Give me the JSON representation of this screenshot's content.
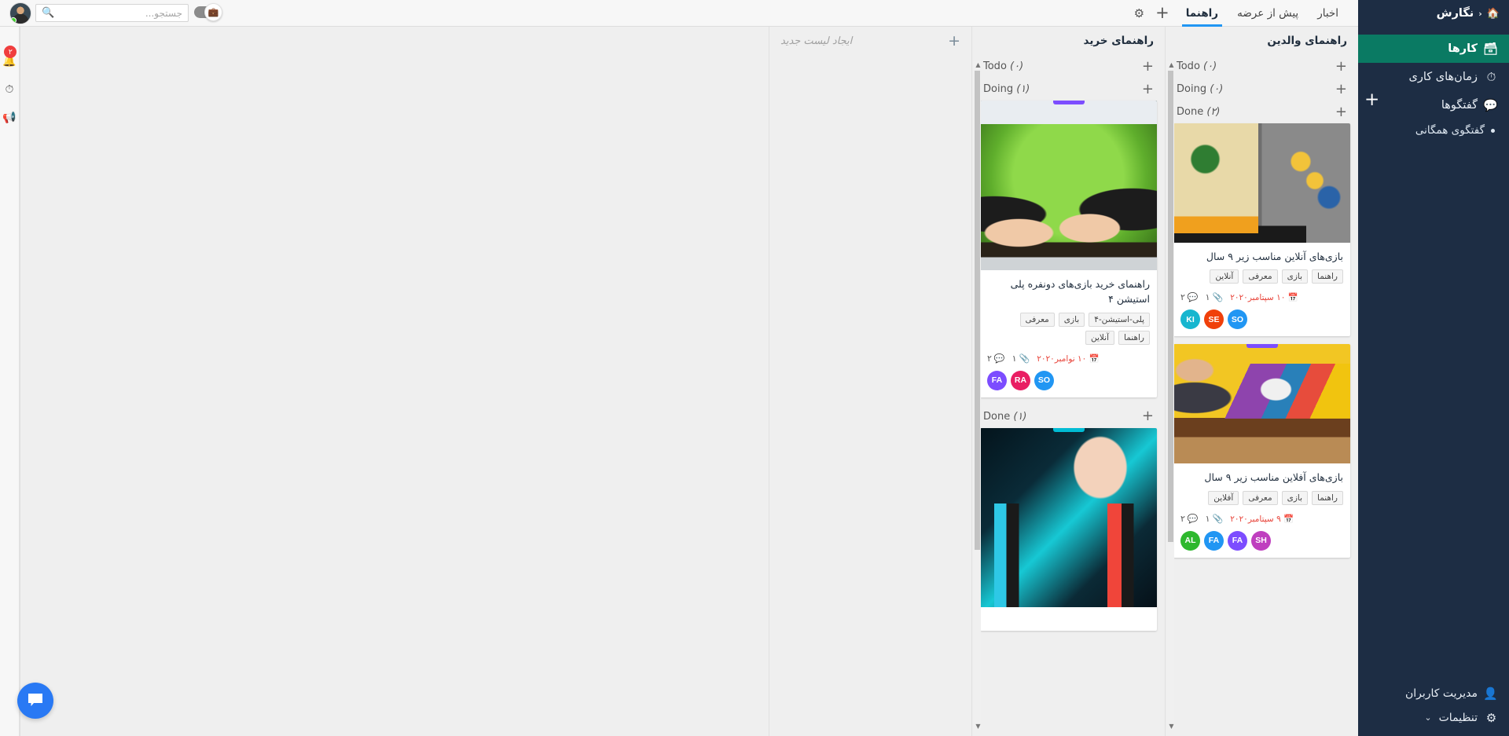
{
  "sidebar": {
    "brand": "نگارش",
    "home_icon": "home-icon",
    "chevron": "‹",
    "items": [
      {
        "label": "کارها",
        "icon": "board-icon",
        "active": true
      },
      {
        "label": "زمان‌های کاری",
        "icon": "stopwatch-icon",
        "active": false
      },
      {
        "label": "گفتگوها",
        "icon": "chat-icon",
        "active": false
      }
    ],
    "sub_items": [
      {
        "label": "گفتگوی همگانی"
      }
    ],
    "add_conversation": "+",
    "bottom_items": [
      {
        "label": "مدیریت کاربران",
        "icon": "users-icon"
      },
      {
        "label": "تنظیمات",
        "icon": "gear-icon",
        "chevron": "⌄"
      }
    ]
  },
  "topbar": {
    "tabs": [
      {
        "label": "اخبار",
        "active": false
      },
      {
        "label": "پیش از عرضه",
        "active": false
      },
      {
        "label": "راهنما",
        "active": true
      }
    ],
    "add_label": "+",
    "gear_label": "⚙",
    "search": {
      "placeholder": "جستجو...",
      "value": ""
    }
  },
  "rail": {
    "notifications_badge": "۲",
    "icons": [
      "bell-icon",
      "stopwatch-icon",
      "megaphone-icon"
    ]
  },
  "board": {
    "new_list": {
      "label": "ایجاد لیست جدید",
      "plus": "+"
    },
    "columns": [
      {
        "title": "راهنمای والدین",
        "swimlanes": [
          {
            "label": "Todo",
            "count": "(۰)",
            "plus": "+",
            "cards": []
          },
          {
            "label": "Doing",
            "count": "(۰)",
            "plus": "+",
            "cards": []
          },
          {
            "label": "Done",
            "count": "(۲)",
            "plus": "+",
            "cards": [
              {
                "bar_color": "",
                "image": "img-kidgames",
                "title": "بازی‌های آنلاین مناسب زیر ۹ سال",
                "tags": [
                  "راهنما",
                  "بازی",
                  "معرفی",
                  "آنلاین"
                ],
                "comments": "۲",
                "attachments": "۱",
                "date": "۱۰ سپتامبر۲۰۲۰",
                "avatars": [
                  {
                    "initials": "KI",
                    "color": "#17b6cf"
                  },
                  {
                    "initials": "SE",
                    "color": "#f0400a"
                  },
                  {
                    "initials": "SO",
                    "color": "#2196f3"
                  }
                ]
              },
              {
                "bar_color": "#7c4dff",
                "image": "img-board",
                "title": "بازی‌های آفلاین مناسب زیر ۹ سال",
                "tags": [
                  "راهنما",
                  "بازی",
                  "معرفی",
                  "آفلاین"
                ],
                "comments": "۲",
                "attachments": "۱",
                "date": "۹ سپتامبر۲۰۲۰",
                "avatars": [
                  {
                    "initials": "AL",
                    "color": "#2eb82e"
                  },
                  {
                    "initials": "FA",
                    "color": "#2196f3"
                  },
                  {
                    "initials": "FA",
                    "color": "#7c4dff"
                  },
                  {
                    "initials": "SH",
                    "color": "#bf3fbf"
                  }
                ]
              }
            ]
          }
        ]
      },
      {
        "title": "راهنمای خرید",
        "swimlanes": [
          {
            "label": "Todo",
            "count": "(۰)",
            "plus": "+",
            "cards": []
          },
          {
            "label": "Doing",
            "count": "(۱)",
            "plus": "+",
            "cards": [
              {
                "bar_color": "#7c4dff",
                "image": "img-ps",
                "title": "راهنمای خرید بازی‌های دونفره پلی استیشن ۴",
                "tags": [
                  "پلی-استیشن-۴",
                  "بازی",
                  "معرفی",
                  "راهنما",
                  "آنلاین"
                ],
                "comments": "۲",
                "attachments": "۱",
                "date": "۱۰ نوامبر۲۰۲۰",
                "avatars": [
                  {
                    "initials": "FA",
                    "color": "#7c4dff"
                  },
                  {
                    "initials": "RA",
                    "color": "#e91e63"
                  },
                  {
                    "initials": "SO",
                    "color": "#2196f3"
                  }
                ]
              }
            ]
          },
          {
            "label": "Done",
            "count": "(۱)",
            "plus": "+",
            "cards": [
              {
                "bar_color": "#00bcd4",
                "image": "img-switch",
                "title": "",
                "tags": [],
                "comments": "",
                "attachments": "",
                "date": "",
                "avatars": []
              }
            ]
          }
        ]
      }
    ]
  },
  "fab": {
    "icon": "chat-bubble-icon"
  },
  "colors": {
    "sidebar_bg": "#1d2d44",
    "active_item": "#0a7a63",
    "tab_underline": "#2196f3",
    "date_red": "#e8443a",
    "fab_blue": "#2979f4"
  }
}
